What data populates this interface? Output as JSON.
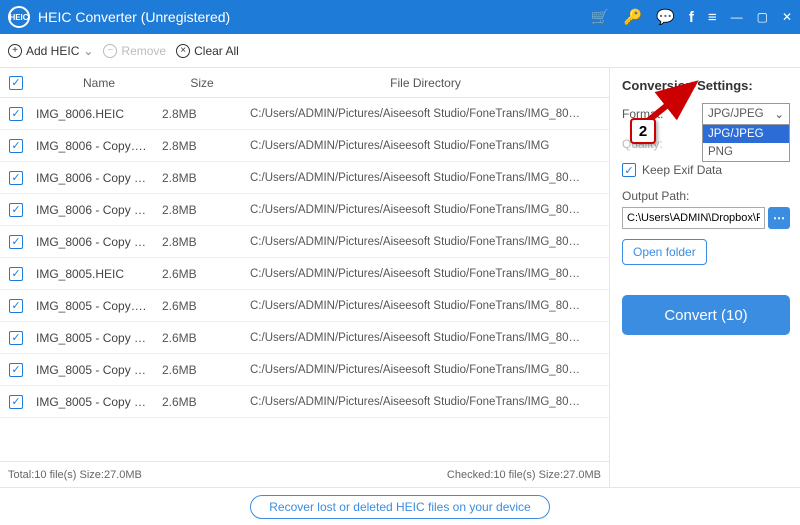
{
  "titlebar": {
    "app_name": "HEIC Converter (Unregistered)",
    "logo_text": "HEIC"
  },
  "toolbar": {
    "add_label": "Add HEIC",
    "remove_label": "Remove",
    "clearall_label": "Clear All"
  },
  "table": {
    "headers": {
      "name": "Name",
      "size": "Size",
      "dir": "File Directory"
    },
    "rows": [
      {
        "name": "IMG_8006.HEIC",
        "size": "2.8MB",
        "dir": "C:/Users/ADMIN/Pictures/Aiseesoft Studio/FoneTrans/IMG_80…"
      },
      {
        "name": "IMG_8006 - Copy….",
        "size": "2.8MB",
        "dir": "C:/Users/ADMIN/Pictures/Aiseesoft Studio/FoneTrans/IMG"
      },
      {
        "name": "IMG_8006 - Copy …",
        "size": "2.8MB",
        "dir": "C:/Users/ADMIN/Pictures/Aiseesoft Studio/FoneTrans/IMG_80…"
      },
      {
        "name": "IMG_8006 - Copy …",
        "size": "2.8MB",
        "dir": "C:/Users/ADMIN/Pictures/Aiseesoft Studio/FoneTrans/IMG_80…"
      },
      {
        "name": "IMG_8006 - Copy …",
        "size": "2.8MB",
        "dir": "C:/Users/ADMIN/Pictures/Aiseesoft Studio/FoneTrans/IMG_80…"
      },
      {
        "name": "IMG_8005.HEIC",
        "size": "2.6MB",
        "dir": "C:/Users/ADMIN/Pictures/Aiseesoft Studio/FoneTrans/IMG_80…"
      },
      {
        "name": "IMG_8005 - Copy….",
        "size": "2.6MB",
        "dir": "C:/Users/ADMIN/Pictures/Aiseesoft Studio/FoneTrans/IMG_80…"
      },
      {
        "name": "IMG_8005 - Copy …",
        "size": "2.6MB",
        "dir": "C:/Users/ADMIN/Pictures/Aiseesoft Studio/FoneTrans/IMG_80…"
      },
      {
        "name": "IMG_8005 - Copy …",
        "size": "2.6MB",
        "dir": "C:/Users/ADMIN/Pictures/Aiseesoft Studio/FoneTrans/IMG_80…"
      },
      {
        "name": "IMG_8005 - Copy …",
        "size": "2.6MB",
        "dir": "C:/Users/ADMIN/Pictures/Aiseesoft Studio/FoneTrans/IMG_80…"
      }
    ]
  },
  "status": {
    "left": "Total:10 file(s) Size:27.0MB",
    "right": "Checked:10 file(s) Size:27.0MB"
  },
  "settings": {
    "title": "Conversion Settings:",
    "format_label": "Format:",
    "format_selected": "JPG/JPEG",
    "format_options": [
      "JPG/JPEG",
      "PNG"
    ],
    "quality_label": "Quality:",
    "keep_exif": "Keep Exif Data",
    "output_label": "Output Path:",
    "output_value": "C:\\Users\\ADMIN\\Dropbox\\PC\\",
    "open_folder": "Open folder",
    "convert": "Convert (10)"
  },
  "footer": {
    "recover": "Recover lost or deleted HEIC files on your device"
  },
  "annotation": {
    "step": "2"
  }
}
